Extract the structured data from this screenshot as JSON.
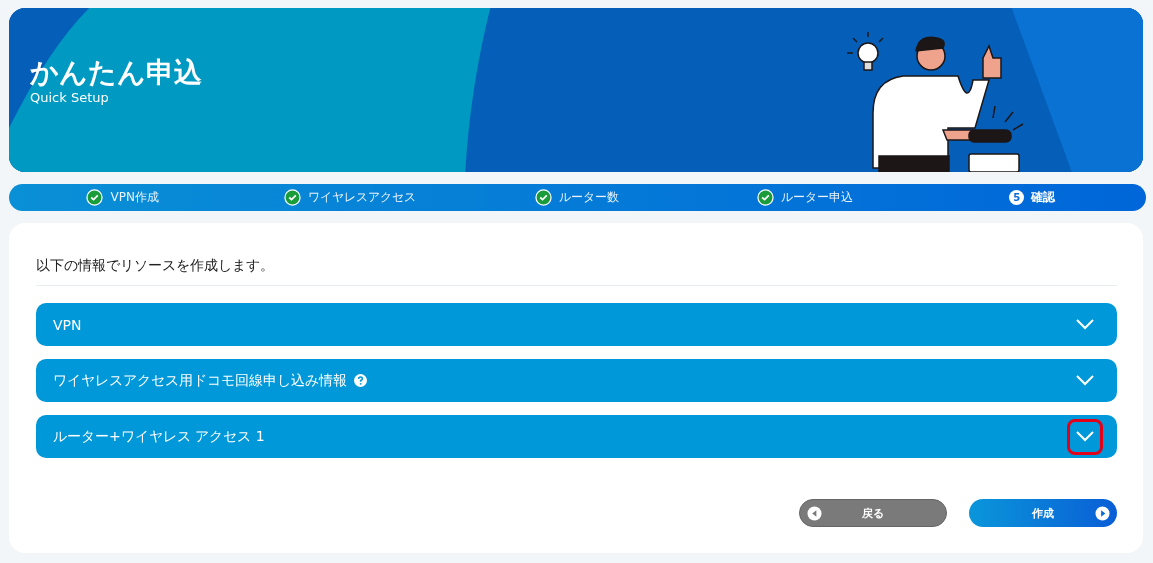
{
  "header": {
    "title": "かんたん申込",
    "subtitle": "Quick Setup"
  },
  "steps": [
    {
      "label": "VPN作成",
      "done": true
    },
    {
      "label": "ワイヤレスアクセス",
      "done": true
    },
    {
      "label": "ルーター数",
      "done": true
    },
    {
      "label": "ルーター申込",
      "done": true
    },
    {
      "label": "確認",
      "done": false,
      "number": "5"
    }
  ],
  "card": {
    "intro": "以下の情報でリソースを作成します。",
    "sections": [
      {
        "title": "VPN",
        "help": false,
        "highlighted": false
      },
      {
        "title": "ワイヤレスアクセス用ドコモ回線申し込み情報",
        "help": true,
        "highlighted": false
      },
      {
        "title": "ルーター+ワイヤレス アクセス 1",
        "help": false,
        "highlighted": true
      }
    ],
    "buttons": [
      {
        "label": "戻る",
        "kind": "back"
      },
      {
        "label": "作成",
        "kind": "next"
      }
    ]
  }
}
